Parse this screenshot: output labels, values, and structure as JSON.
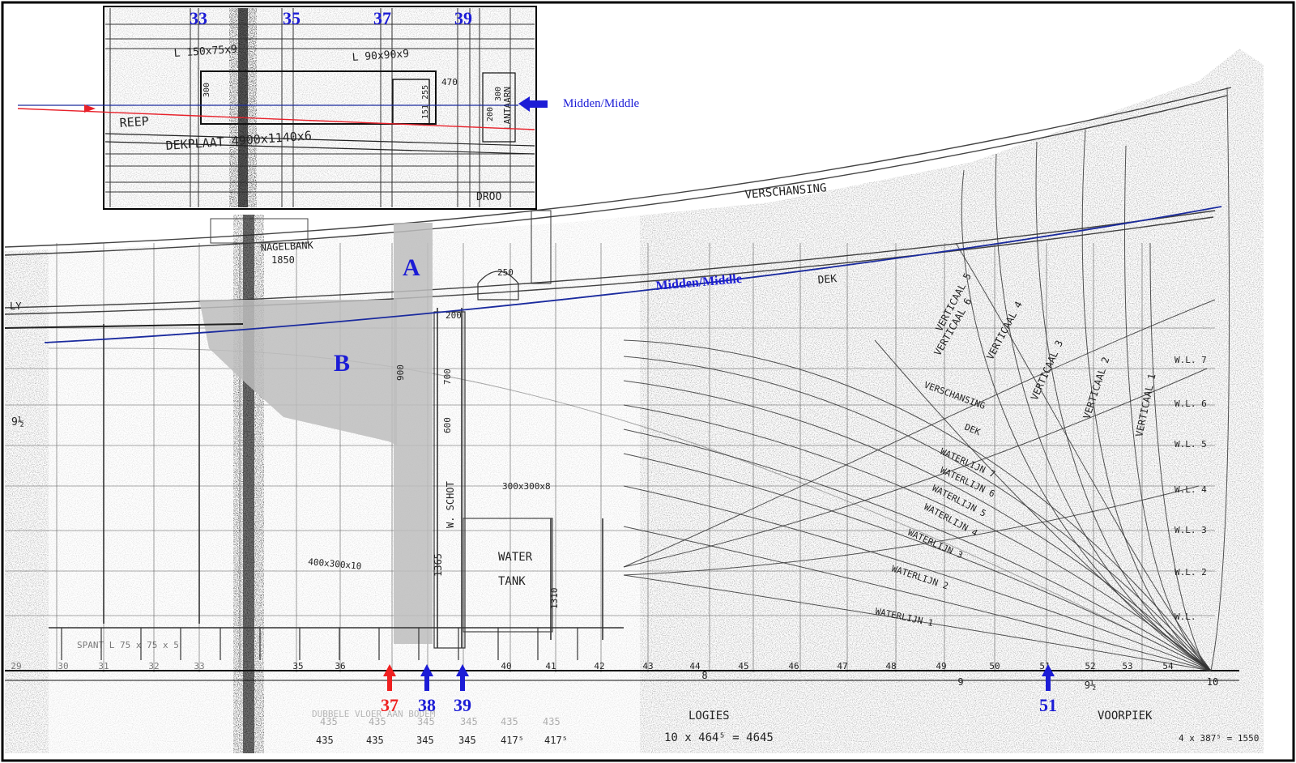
{
  "inset": {
    "frame_numbers": [
      "33",
      "35",
      "37",
      "39"
    ],
    "notes": [
      "L 150x75x9",
      "L 90x90x9",
      "REEP",
      "DEKPLAAT 4900x1140x6",
      "LANTAARN",
      "DROO"
    ],
    "dimensions": [
      "300",
      "470",
      "300",
      "151 255",
      "200"
    ],
    "midden_label": "Midden/Middle"
  },
  "main": {
    "labels": {
      "verschansing_top": "VERSCHANSING",
      "dek_top": "DEK",
      "nagelbank": "NAGELBANK",
      "nagelbank_dim": "1850",
      "ly": "LY",
      "fraction": "9½",
      "midden": "Midden/Middle",
      "region_a": "A",
      "region_b": "B",
      "water": "WATER",
      "tank": "TANK",
      "w_schot": "W. SCHOT",
      "profile": "300x300x8",
      "profile2": "400x300x10",
      "spant": "SPANT L 75 x 75 x 5",
      "dim_1365": "1365",
      "dim_1310": "1310",
      "dim_900": "900",
      "dim_700": "700",
      "dim_200": "200",
      "dim_250": "250",
      "dim_600": "600",
      "dubbele": "DUBBELE VLOER AAN BODEM",
      "logies": "LOGIES",
      "voorpiek": "VOORPIEK",
      "logies_dims": "10 x 464⁵ = 4645",
      "voorpiek_dims": "4 x 387⁵ = 1550",
      "bottom_dims": [
        "435",
        "435",
        "345",
        "345",
        "417⁵",
        "417⁵"
      ],
      "bottom_dims_faint": [
        "435",
        "435",
        "345",
        "345",
        "435",
        "435"
      ],
      "verticaal": [
        "VERTICAAL 6",
        "VERTICAAL 5",
        "VERTICAAL 4",
        "VERTICAAL 3",
        "VERTICAAL 2",
        "VERTICAAL 1"
      ],
      "waterlijn_labels": [
        "VERSCHANSING",
        "DEK",
        "WATERLIJN 7",
        "WATERLIJN 6",
        "WATERLIJN 5",
        "WATERLIJN 4",
        "WATERLIJN 3",
        "WATERLIJN 2",
        "WATERLIJN 1"
      ],
      "wl_labels": [
        "W.L. 7",
        "W.L. 6",
        "W.L. 5",
        "W.L. 4",
        "W.L. 3",
        "W.L. 2",
        "W.L."
      ],
      "frame_ticks": [
        "29",
        "30",
        "31",
        "32",
        "33",
        "35",
        "36",
        "40",
        "41",
        "42",
        "43",
        "44",
        "45",
        "46",
        "47",
        "48",
        "49",
        "50",
        "51",
        "52",
        "53",
        "54"
      ],
      "station_numbers": [
        "8",
        "9",
        "9½",
        "10"
      ]
    },
    "markers": [
      {
        "label": "37",
        "color": "#ef2020"
      },
      {
        "label": "38",
        "color": "#1c1cd6"
      },
      {
        "label": "39",
        "color": "#1c1cd6"
      },
      {
        "label": "51",
        "color": "#1c1cd6"
      }
    ]
  },
  "colors": {
    "annotation_blue": "#1c1cd6",
    "midden_line": "#1a2a9e",
    "reference_red": "#e8202a",
    "shading": "#bdbdbd"
  }
}
